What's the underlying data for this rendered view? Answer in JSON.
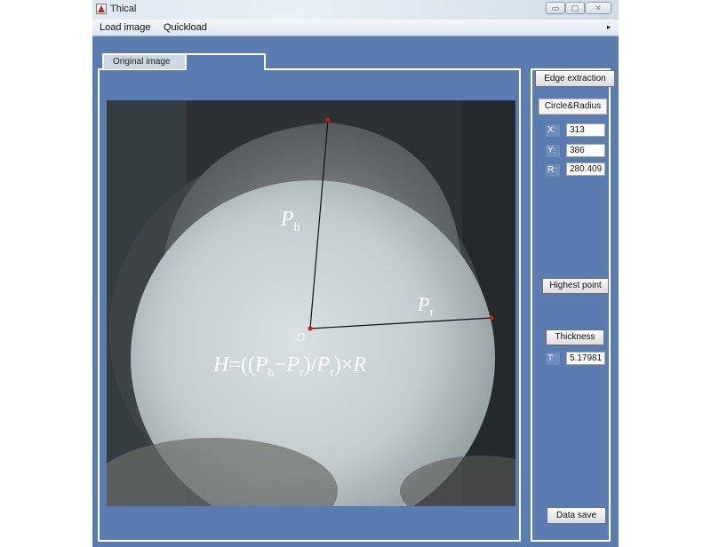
{
  "window": {
    "title": "Thical",
    "min_symbol": "▭",
    "max_symbol": "▢",
    "close_symbol": "✕"
  },
  "menu": {
    "load_image": "Load image",
    "quickload": "Quickload",
    "overflow_arrow": "▸"
  },
  "tabs": {
    "original": "Original image",
    "second": ""
  },
  "annotations": {
    "ph_main": "P",
    "ph_sub": "h",
    "pr_main": "P",
    "pr_sub": "r",
    "origin": "O",
    "formula_H": "H",
    "formula_eq": "=((",
    "formula_P1": "P",
    "formula_h": "h",
    "formula_minus": "−",
    "formula_P2": "P",
    "formula_r1": "r",
    "formula_div": ")/",
    "formula_P3": "P",
    "formula_r2": "r",
    "formula_times": ")×",
    "formula_R": "R"
  },
  "controls": {
    "edge_extraction": "Edge extraction",
    "circle_radius": "Circle&Radius",
    "x_label": "X:",
    "x_value": "313",
    "y_label": "Y:",
    "y_value": "386",
    "r_label": "R:",
    "r_value": "280.409",
    "highest_point": "Highest point",
    "thickness": "Thickness",
    "t_label": "T:",
    "t_value": "5.17981",
    "data_save": "Data save"
  },
  "colors": {
    "window_bg": "#5b7cb0",
    "point_marker": "#d01818",
    "line": "#111111"
  }
}
